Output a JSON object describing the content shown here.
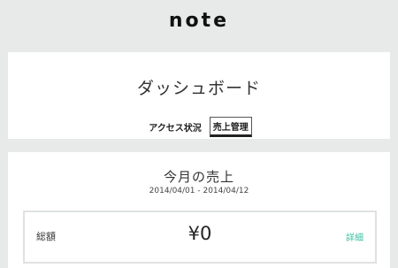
{
  "header": {
    "logo_text": "note"
  },
  "dashboard": {
    "title": "ダッシュボード",
    "tabs": [
      {
        "label": "アクセス状況",
        "active": false
      },
      {
        "label": "売上管理",
        "active": true
      }
    ]
  },
  "sales": {
    "title": "今月の売上",
    "date_range": "2014/04/01 - 2014/04/12",
    "total": {
      "label": "総額",
      "value": "¥0",
      "detail_link": "詳細"
    }
  },
  "colors": {
    "background": "#e8eaea",
    "card": "#ffffff",
    "accent_link": "#3fbfa2"
  }
}
